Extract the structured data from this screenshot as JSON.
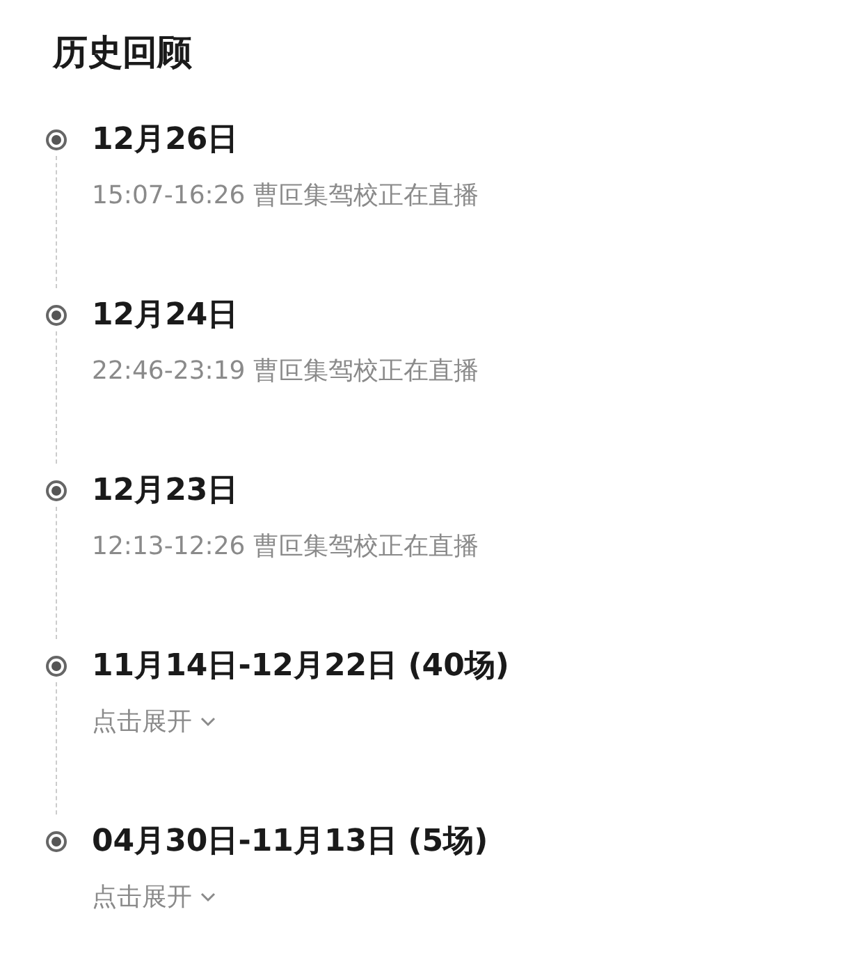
{
  "title": "历史回顾",
  "entries": [
    {
      "kind": "session",
      "date": "12月26日",
      "detail": "15:07-16:26 曹叵集驾校正在直播"
    },
    {
      "kind": "session",
      "date": "12月24日",
      "detail": "22:46-23:19 曹叵集驾校正在直播"
    },
    {
      "kind": "session",
      "date": "12月23日",
      "detail": "12:13-12:26 曹叵集驾校正在直播"
    },
    {
      "kind": "range",
      "date": "11月14日-12月22日 (40场)",
      "action": "点击展开"
    },
    {
      "kind": "range",
      "date": "04月30日-11月13日 (5场)",
      "action": "点击展开"
    }
  ]
}
